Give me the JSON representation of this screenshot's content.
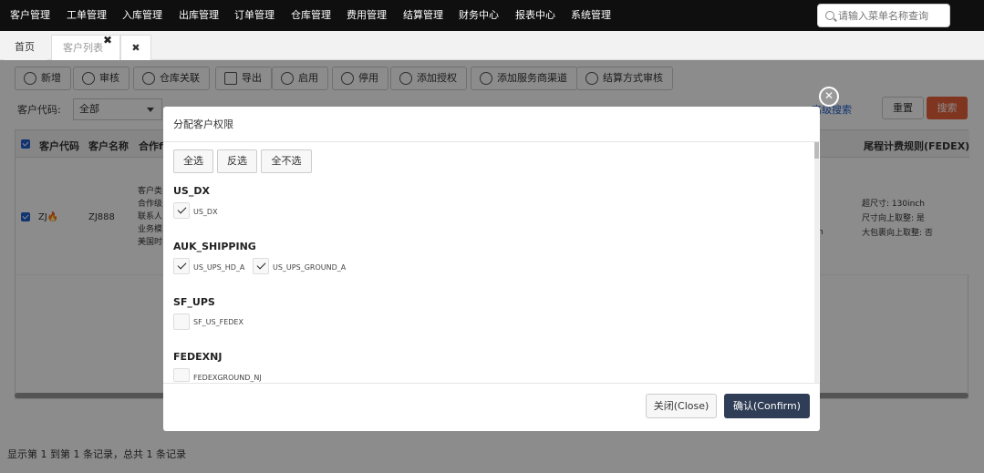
{
  "topnav": {
    "items": [
      "客户管理",
      "工单管理",
      "入库管理",
      "出库管理",
      "订单管理",
      "仓库管理",
      "费用管理",
      "结算管理",
      "财务中心",
      "报表中心",
      "系统管理"
    ],
    "search_placeholder": "请输入菜单名称查询"
  },
  "tabs": [
    {
      "label": "首页"
    },
    {
      "label": "客户列表"
    }
  ],
  "toolbar": [
    "新增",
    "审核",
    "仓库关联",
    "导出",
    "启用",
    "停用",
    "添加授权",
    "添加服务商渠道",
    "结算方式审核"
  ],
  "filters": {
    "customer_code_label": "客户代码:",
    "customer_code_value": "全部",
    "advanced_search": "高级搜索",
    "reset": "重置",
    "search": "搜索"
  },
  "table": {
    "headers": [
      "客户代码",
      "客户名称",
      "合作f",
      "尾程计费规则(FEDEX)"
    ],
    "rows": [
      {
        "code": "ZJ",
        "name": "ZJ888",
        "cooperation": [
          "客户类",
          "合作级",
          "联系人",
          "业务模",
          "美国时"
        ],
        "fedex_rules": [
          "超尺寸: 130inch",
          "尺寸向上取整: 是",
          "大包裹向上取整: 否"
        ],
        "partial_n": "n"
      }
    ]
  },
  "footer": "显示第 1 到第 1 条记录，总共 1 条记录",
  "modal": {
    "title": "分配客户权限",
    "select_all": "全选",
    "invert": "反选",
    "select_none": "全不选",
    "groups": [
      {
        "name": "US_DX",
        "items": [
          {
            "label": "US_DX",
            "checked": true
          }
        ]
      },
      {
        "name": "AUK_SHIPPING",
        "items": [
          {
            "label": "US_UPS_HD_A",
            "checked": true
          },
          {
            "label": "US_UPS_GROUND_A",
            "checked": true
          }
        ]
      },
      {
        "name": "SF_UPS",
        "items": [
          {
            "label": "SF_US_FEDEX",
            "checked": false
          }
        ]
      },
      {
        "name": "FEDEXNJ",
        "items": [
          {
            "label": "FEDEXGROUND_NJ",
            "checked": false
          }
        ]
      }
    ],
    "close_label": "关闭(Close)",
    "confirm_label": "确认(Confirm)"
  }
}
